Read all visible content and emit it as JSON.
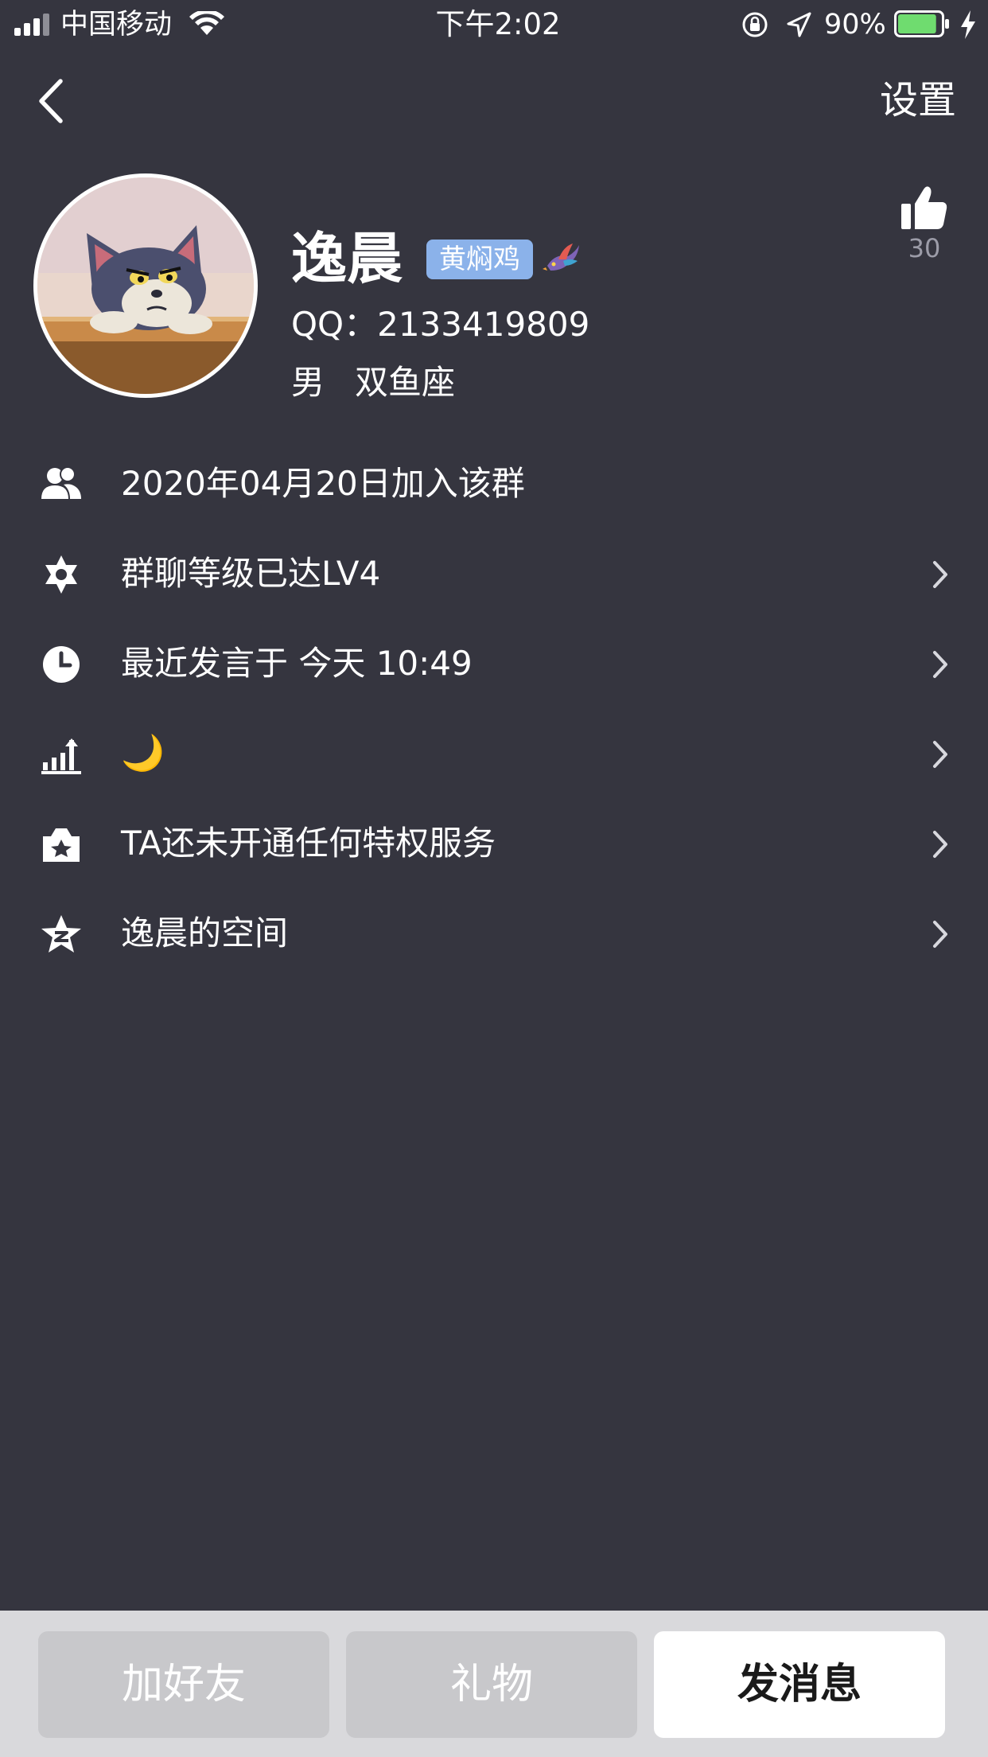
{
  "status_bar": {
    "carrier": "中国移动",
    "time": "下午2:02",
    "battery_percent": "90%",
    "battery_level": 0.9,
    "signal_bars": 4
  },
  "nav": {
    "settings_label": "设置"
  },
  "profile": {
    "nickname": "逸晨",
    "title_badge": "黄焖鸡",
    "qq_line": "QQ：2133419809",
    "gender": "男",
    "zodiac": "双鱼座",
    "like_count": "30"
  },
  "info_rows": [
    {
      "icon": "members-icon",
      "text": "2020年04月20日加入该群",
      "has_chevron": false
    },
    {
      "icon": "level-star-icon",
      "text": "群聊等级已达LV4",
      "has_chevron": true
    },
    {
      "icon": "clock-icon",
      "text": "最近发言于 今天 10:49",
      "has_chevron": true
    },
    {
      "icon": "rank-chart-icon",
      "text": "🌙",
      "has_chevron": true
    },
    {
      "icon": "privilege-crown-icon",
      "text": "TA还未开通任何特权服务",
      "has_chevron": true
    },
    {
      "icon": "qzone-star-icon",
      "text": "逸晨的空间",
      "has_chevron": true
    }
  ],
  "actions": {
    "add_friend": "加好友",
    "gift": "礼物",
    "send_message": "发消息"
  },
  "colors": {
    "background": "#35353f",
    "badge": "#8bb2ea",
    "bottom_bar": "#d9d9dc",
    "disabled_button": "#c8c8cb",
    "primary_button": "#ffffff",
    "battery_fill": "#6fdc6f"
  }
}
